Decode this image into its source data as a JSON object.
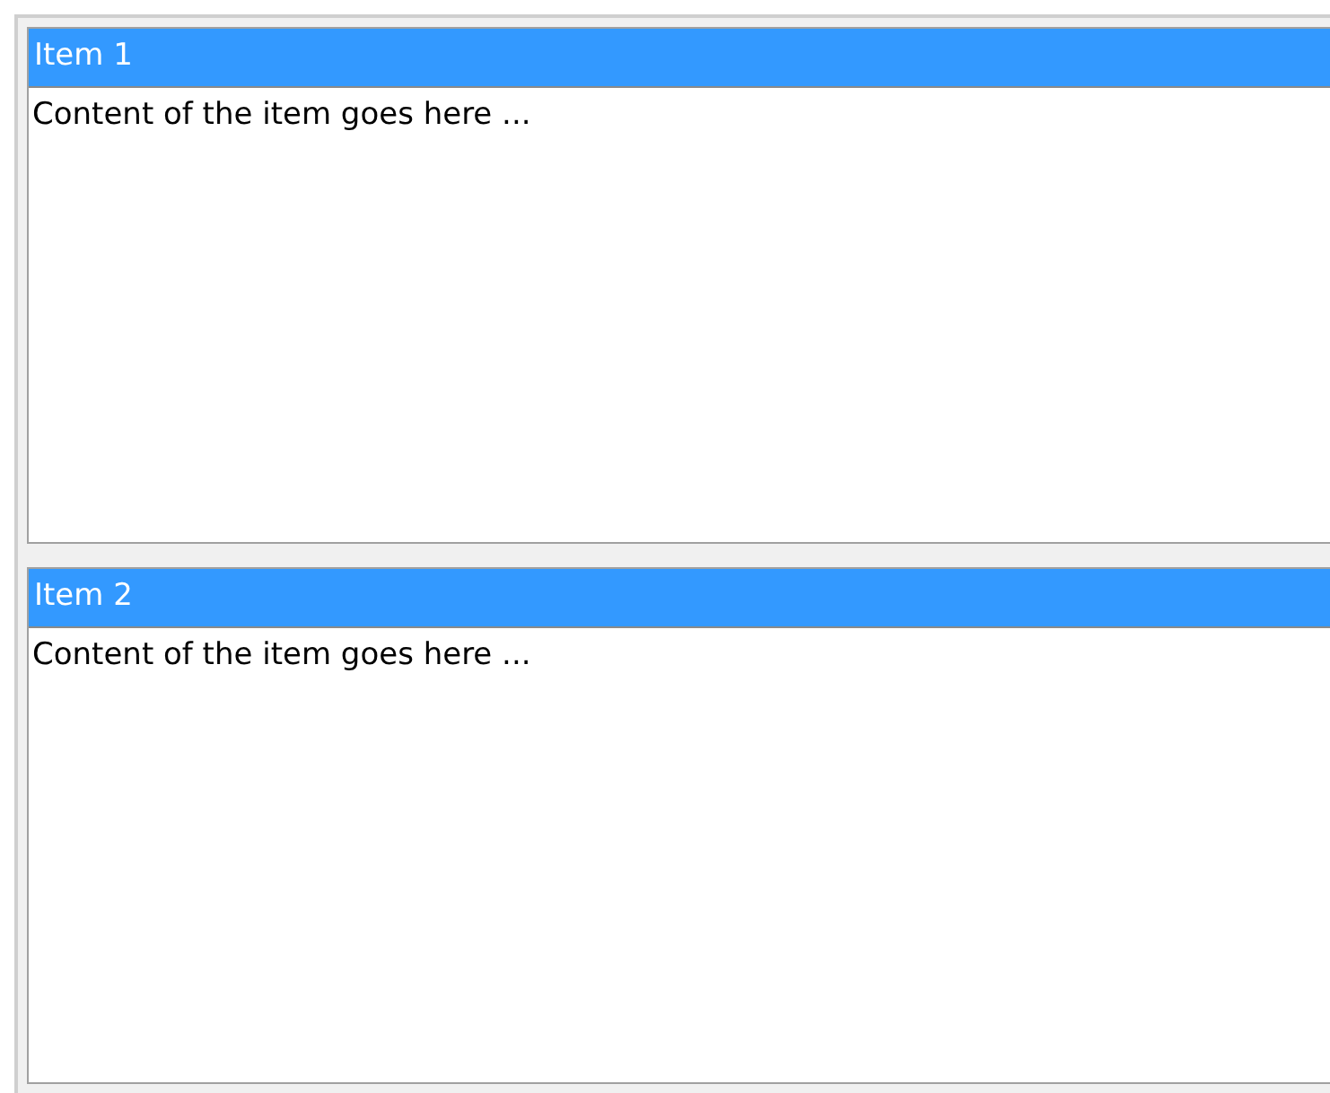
{
  "panels": [
    {
      "title": "Item 1",
      "content": "Content of the item goes here ..."
    },
    {
      "title": "Item 2",
      "content": "Content of the item goes here ..."
    }
  ]
}
